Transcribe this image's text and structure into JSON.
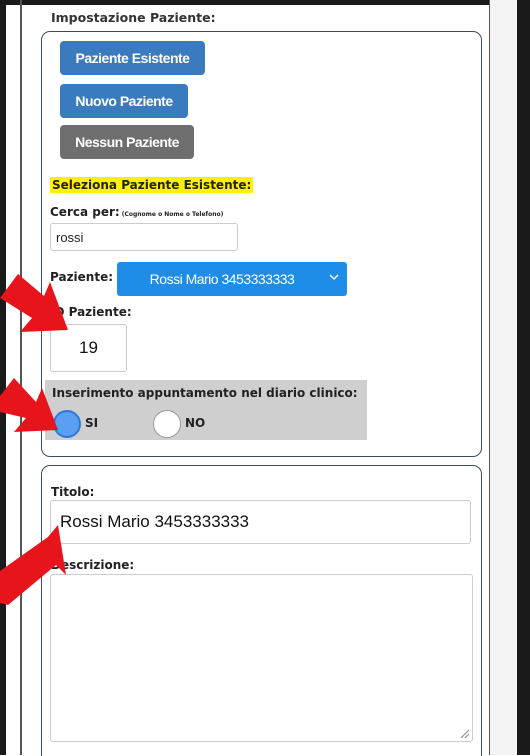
{
  "section_heading": "Impostazione Paziente:",
  "buttons": {
    "existing": "Paziente Esistente",
    "new": "Nuovo Paziente",
    "none": "Nessun Paziente"
  },
  "select_existing_label": "Seleziona Paziente Esistente:",
  "search": {
    "label": "Cerca per:",
    "hint": "(Cognome o Nome o Telefono)",
    "value": "rossi"
  },
  "patient": {
    "label": "Paziente:",
    "selected": "Rossi Mario 3453333333"
  },
  "patient_id": {
    "label": "ID Paziente:",
    "value": "19"
  },
  "diary": {
    "label": "Inserimento appuntamento nel diario clinico:",
    "option_yes": "SI",
    "option_no": "NO",
    "selected": "SI"
  },
  "details": {
    "title_label": "Titolo:",
    "title_value": "Rossi Mario 3453333333",
    "description_label": "Descrizione:",
    "description_value": ""
  },
  "colors": {
    "primary_button": "#3a7bbf",
    "neutral_button": "#6e6e6e",
    "select_bg": "#1d8de8",
    "highlight": "#fff200",
    "annotation_arrow": "#e8141b"
  }
}
